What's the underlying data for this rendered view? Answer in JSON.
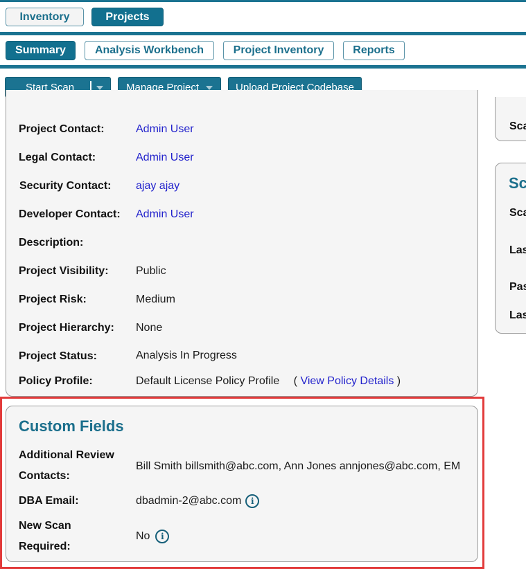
{
  "nav": {
    "tabs": [
      "Inventory",
      "Projects"
    ],
    "active": "Projects"
  },
  "subnav": {
    "tabs": [
      "Summary",
      "Analysis Workbench",
      "Project Inventory",
      "Reports"
    ],
    "active": "Summary"
  },
  "toolbar": {
    "start_scan": "Start Scan",
    "manage_project": "Manage Project",
    "upload_codebase": "Upload Project Codebase"
  },
  "details": {
    "project_contact": {
      "label": "Project Contact:",
      "value": "Admin User"
    },
    "legal_contact": {
      "label": "Legal Contact:",
      "value": "Admin User"
    },
    "security_contact": {
      "label": "Security Contact:",
      "value": "ajay ajay"
    },
    "developer_contact": {
      "label": "Developer Contact:",
      "value": "Admin User"
    },
    "description": {
      "label": "Description:",
      "value": ""
    },
    "visibility": {
      "label": "Project Visibility:",
      "value": "Public"
    },
    "risk": {
      "label": "Project Risk:",
      "value": "Medium"
    },
    "hierarchy": {
      "label": "Project Hierarchy:",
      "value": "None"
    },
    "status": {
      "label": "Project Status:",
      "value": "Analysis In Progress"
    },
    "policy_profile": {
      "label": "Policy Profile:",
      "value": "Default License Policy Profile",
      "link_open": "(",
      "link": "View Policy Details",
      "link_close": ")"
    }
  },
  "custom_fields": {
    "title": "Custom Fields",
    "additional_review": {
      "label_line1": "Additional Review",
      "label_line2": "Contacts:",
      "value": "Bill Smith billsmith@abc.com, Ann Jones annjones@abc.com, EM"
    },
    "dba_email": {
      "label": "DBA Email:",
      "value": "dbadmin-2@abc.com"
    },
    "new_scan": {
      "label_line1": "New Scan",
      "label_line2": "Required:",
      "value": "No"
    }
  },
  "side": {
    "panel1_label": "Sca",
    "panel2_title": "Sc",
    "panel2_rows": [
      "Sca",
      "Las",
      "Pas",
      "Las"
    ]
  },
  "icons": {
    "info": "i"
  },
  "colors": {
    "brand_teal": "#1b7391",
    "link": "#2222cc",
    "highlight_red": "#e23b3b"
  }
}
